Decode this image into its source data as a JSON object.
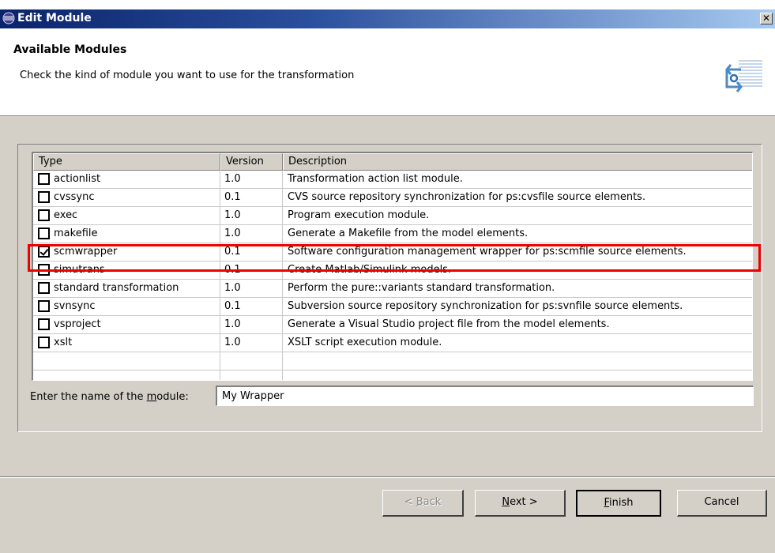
{
  "window": {
    "title": "Edit Module",
    "close_glyph": "✕"
  },
  "header": {
    "title": "Available Modules",
    "description": "Check the kind of module you want to use for the transformation",
    "icon": "wizard-refresh-icon"
  },
  "table": {
    "columns": [
      "Type",
      "Version",
      "Description"
    ],
    "rows": [
      {
        "type": "actionlist",
        "version": "1.0",
        "description": "Transformation action list module.",
        "checked": false
      },
      {
        "type": "cvssync",
        "version": "0.1",
        "description": "CVS source repository synchronization for ps:cvsfile source elements.",
        "checked": false
      },
      {
        "type": "exec",
        "version": "1.0",
        "description": "Program execution module.",
        "checked": false
      },
      {
        "type": "makefile",
        "version": "1.0",
        "description": "Generate a Makefile from the model elements.",
        "checked": false
      },
      {
        "type": "scmwrapper",
        "version": "0.1",
        "description": "Software configuration management wrapper for ps:scmfile source elements.",
        "checked": true
      },
      {
        "type": "simutrans",
        "version": "0.1",
        "description": "Create Matlab/Simulink models.",
        "checked": false
      },
      {
        "type": "standard transformation",
        "version": "1.0",
        "description": "Perform the pure::variants standard transformation.",
        "checked": false
      },
      {
        "type": "svnsync",
        "version": "0.1",
        "description": "Subversion source repository synchronization for ps:svnfile source elements.",
        "checked": false
      },
      {
        "type": "vsproject",
        "version": "1.0",
        "description": "Generate a Visual Studio project file from the model elements.",
        "checked": false
      },
      {
        "type": "xslt",
        "version": "1.0",
        "description": "XSLT script execution module.",
        "checked": false
      }
    ]
  },
  "name_field": {
    "label_before": "Enter the name of the ",
    "label_mnemonic": "m",
    "label_after": "odule:",
    "value": "My Wrapper"
  },
  "buttons": {
    "back_prefix": "< ",
    "back_mnemonic": "B",
    "back_rest": "ack",
    "next_mnemonic": "N",
    "next_rest": "ext >",
    "finish_mnemonic": "F",
    "finish_rest": "inish",
    "cancel": "Cancel"
  },
  "colors": {
    "highlight": "#ee0000",
    "dialog_bg": "#d4d0c8",
    "titlebar_start": "#0a246a"
  }
}
